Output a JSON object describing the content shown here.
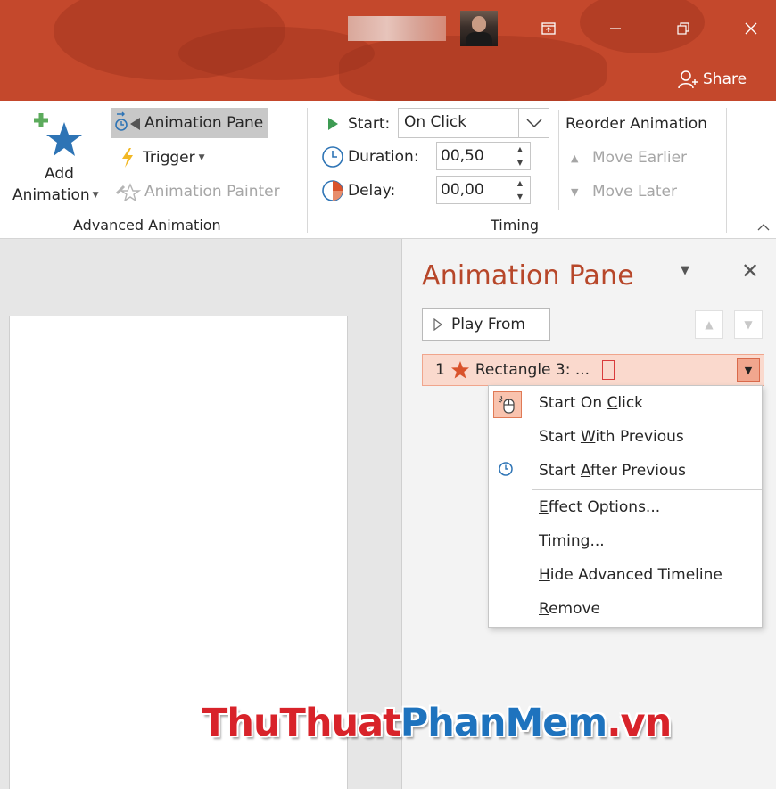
{
  "titlebar": {
    "share_label": "Share",
    "buttons": [
      "ribbon-display-options",
      "minimize",
      "restore",
      "close"
    ]
  },
  "ribbon": {
    "advanced_animation": {
      "add_animation_line1": "Add",
      "add_animation_line2": "Animation",
      "animation_pane_label": "Animation Pane",
      "trigger_label": "Trigger",
      "animation_painter_label": "Animation Painter",
      "group_label": "Advanced Animation"
    },
    "timing": {
      "start_label": "Start:",
      "start_value": "On Click",
      "duration_label": "Duration:",
      "duration_value": "00,50",
      "delay_label": "Delay:",
      "delay_value": "00,00",
      "reorder_label": "Reorder Animation",
      "move_earlier_label": "Move Earlier",
      "move_later_label": "Move Later",
      "group_label": "Timing"
    }
  },
  "animation_pane": {
    "title": "Animation Pane",
    "play_from_label": "Play From",
    "item": {
      "number": "1",
      "label": "Rectangle 3: ..."
    }
  },
  "context_menu": {
    "items": [
      {
        "pre": "Start On ",
        "u": "C",
        "post": "lick",
        "icon": "mouse-click-icon"
      },
      {
        "pre": "Start ",
        "u": "W",
        "post": "ith Previous"
      },
      {
        "pre": "Start ",
        "u": "A",
        "post": "fter Previous",
        "icon": "clock-icon"
      },
      {
        "pre": "",
        "u": "E",
        "post": "ffect Options..."
      },
      {
        "pre": "",
        "u": "T",
        "post": "iming..."
      },
      {
        "pre": "",
        "u": "H",
        "post": "ide Advanced Timeline"
      },
      {
        "pre": "",
        "u": "R",
        "post": "emove"
      }
    ]
  },
  "watermark": {
    "part1": "ThuThuat",
    "part2": "PhanMem",
    "part3": ".vn"
  },
  "colors": {
    "title_bar": "#c4482c",
    "accent": "#b7472a",
    "selected_item_bg": "#fad9cd"
  }
}
